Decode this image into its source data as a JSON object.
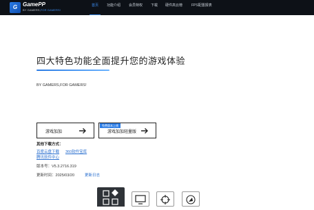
{
  "header": {
    "logo_badge": "G",
    "logo_name": "GamePP",
    "logo_tag_prefix": "BY GAMERS,",
    "logo_tag_suffix": "FOR GAMERS!",
    "nav": [
      {
        "label": "首页",
        "active": true
      },
      {
        "label": "功能介绍",
        "active": false
      },
      {
        "label": "会员特权",
        "active": false
      },
      {
        "label": "下载",
        "active": false
      },
      {
        "label": "硬件高云榜",
        "active": false
      },
      {
        "label": "FPS配置报表",
        "active": false
      }
    ]
  },
  "hero": {
    "title": "四大特色功能全面提升您的游戏体验",
    "subtitle": "BY GAMERS,FOR GAMERS!"
  },
  "downloads": {
    "primary_label": "游戏加加",
    "secondary_label": "游戏加加轻量版",
    "secondary_badge": "免费版本上线",
    "other_title": "其他下载方式：",
    "links": [
      "百度云盘下载",
      "360软件宝库",
      "腾讯软件中心"
    ]
  },
  "meta": {
    "version_label": "版本号：",
    "version_value": "V5.3.2716.319",
    "updated_label": "更新时间：",
    "updated_value": "2025/03/20",
    "changelog_label": "更新日志"
  },
  "features": [
    "grid-diamond-icon",
    "monitor-icon",
    "crosshair-icon",
    "compass-icon"
  ],
  "colors": {
    "topbar": "#0d1117",
    "accent": "#2a7be4",
    "link": "#2a6fcf"
  }
}
